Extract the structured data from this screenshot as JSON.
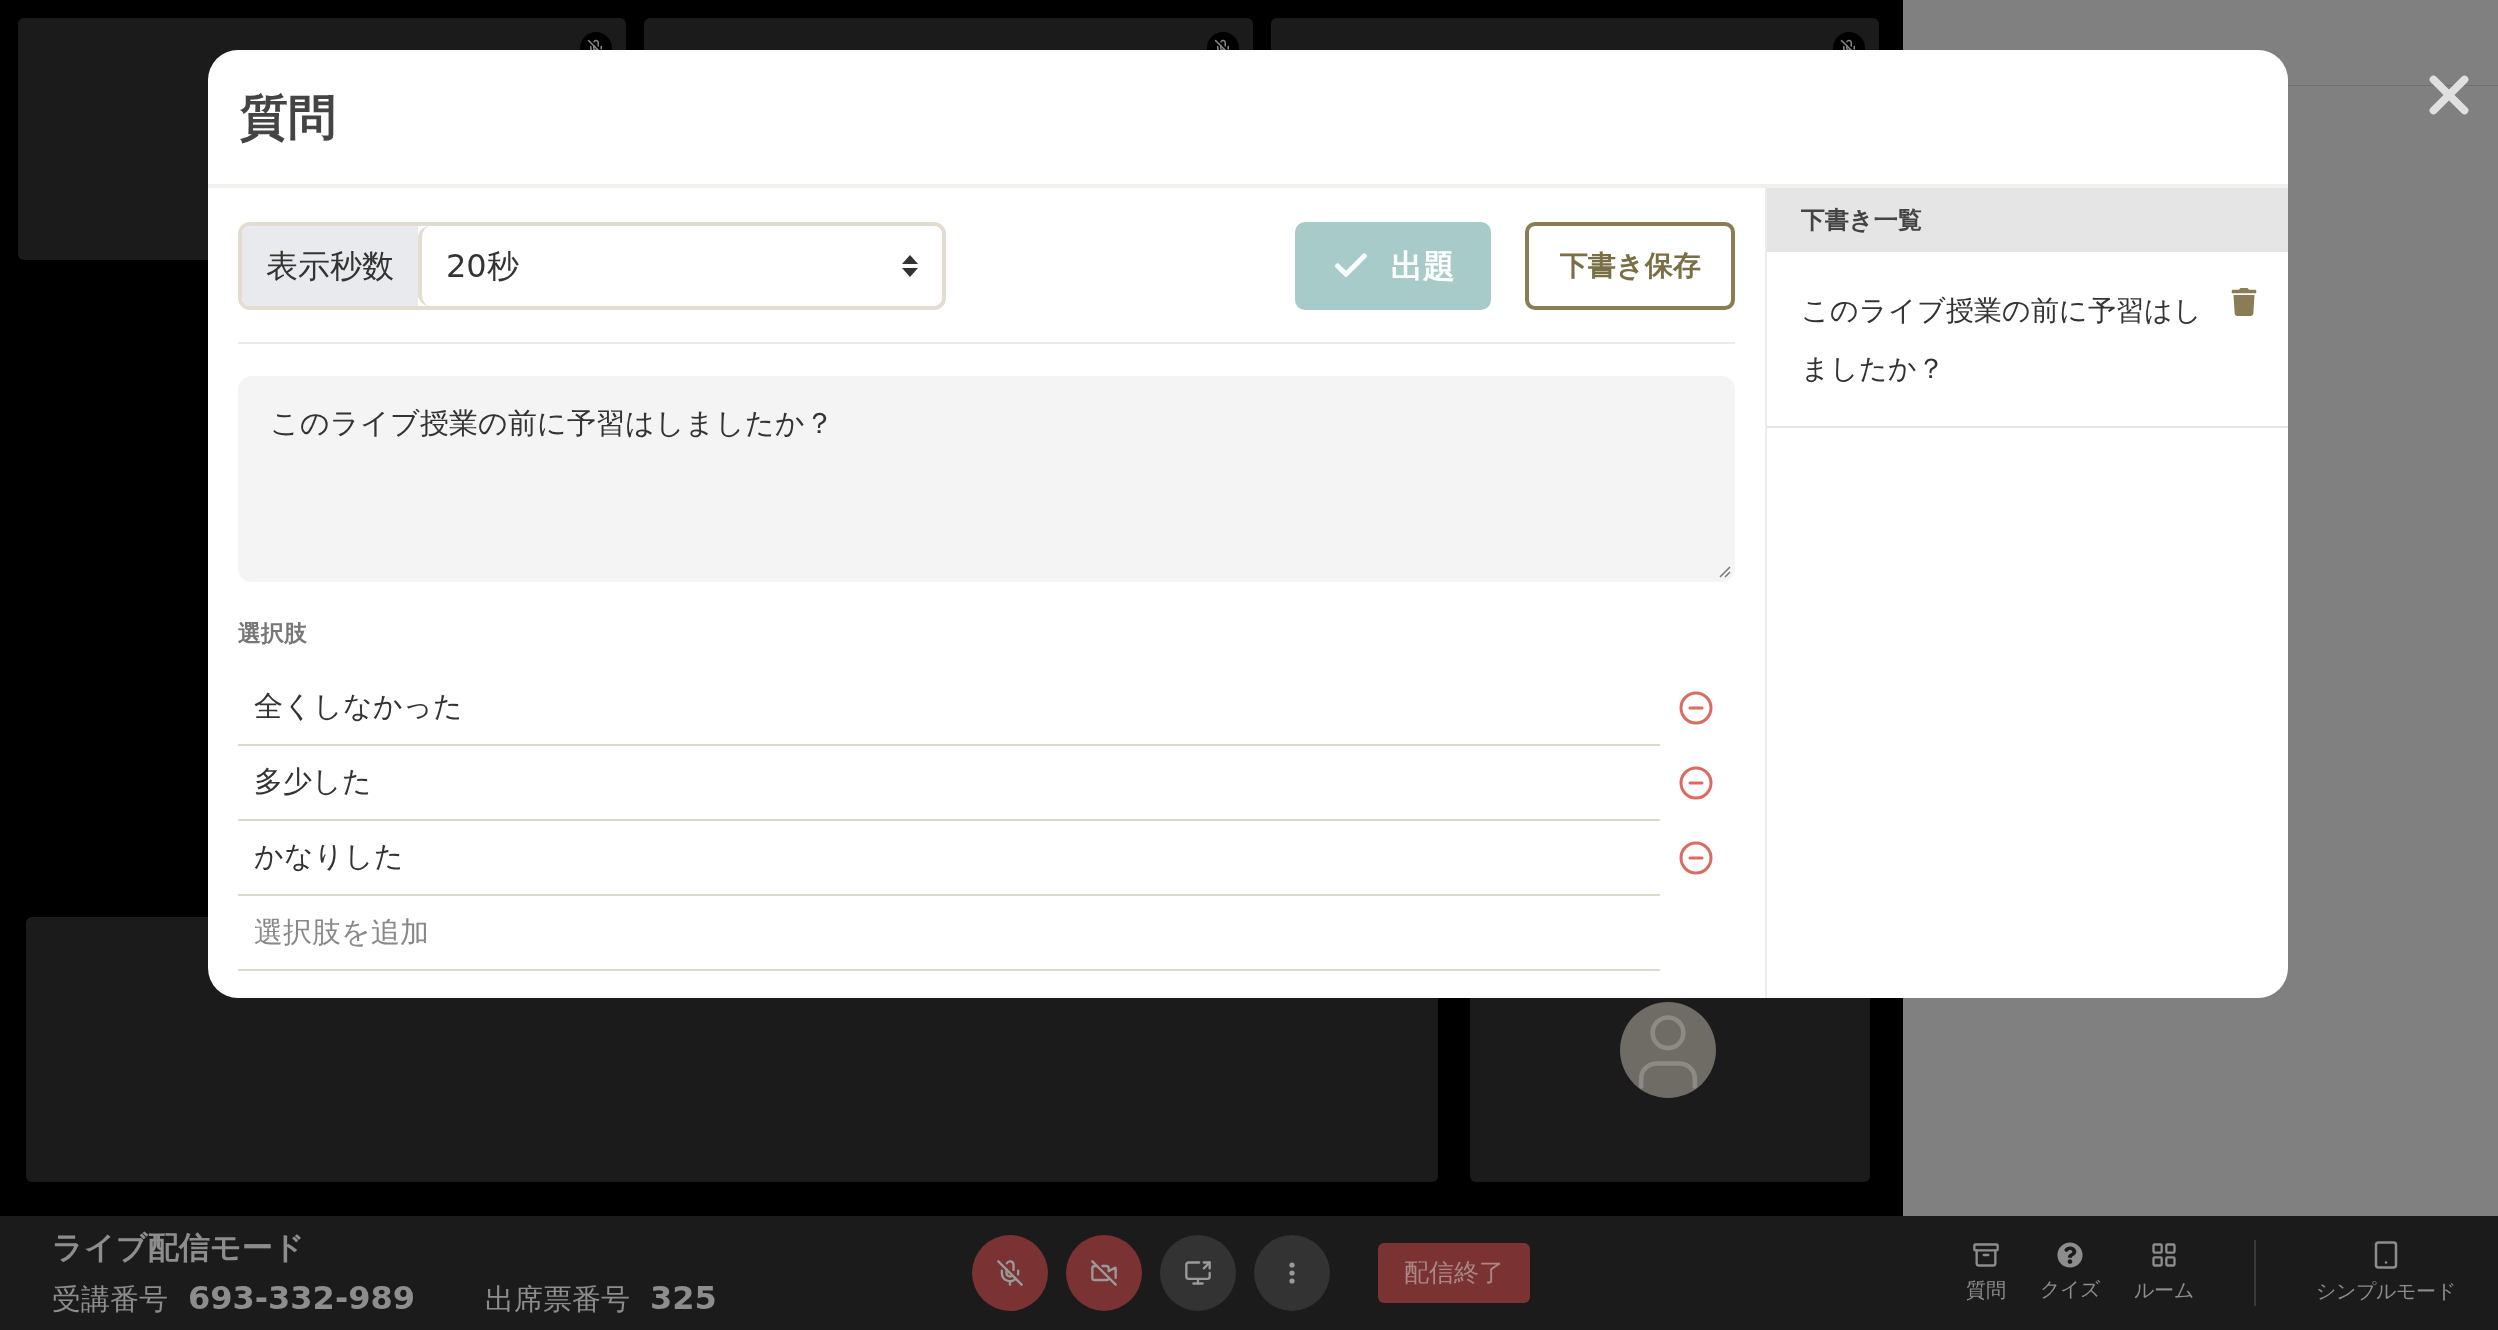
{
  "bottom_bar": {
    "mode_title": "ライブ配信モード",
    "fields": [
      {
        "label": "受講番号",
        "value": "693-332-989"
      },
      {
        "label": "出席票番号",
        "value": "325"
      }
    ],
    "media": [
      {
        "kind": "mic",
        "on": false
      },
      {
        "kind": "camera",
        "on": false
      },
      {
        "kind": "share"
      },
      {
        "kind": "more"
      }
    ],
    "end_button": "配信終了",
    "nav": [
      {
        "kind": "question",
        "label": "質問"
      },
      {
        "kind": "quiz",
        "label": "クイズ"
      },
      {
        "kind": "room",
        "label": "ルーム"
      }
    ],
    "simple_mode": "シンプルモード"
  },
  "modal": {
    "title": "質問",
    "duration": {
      "label": "表示秒数",
      "value": "20秒"
    },
    "publish_button": "出題",
    "save_button": "下書き保存",
    "question": "このライブ授業の前に予習はしましたか？",
    "choices_label": "選択肢",
    "choices": [
      "全くしなかった",
      "多少した",
      "かなりした"
    ],
    "add_placeholder": "選択肢を追加",
    "drafts": {
      "title": "下書き一覧",
      "items": [
        {
          "text": "このライブ授業の前に予習はしましたか？"
        }
      ]
    }
  }
}
